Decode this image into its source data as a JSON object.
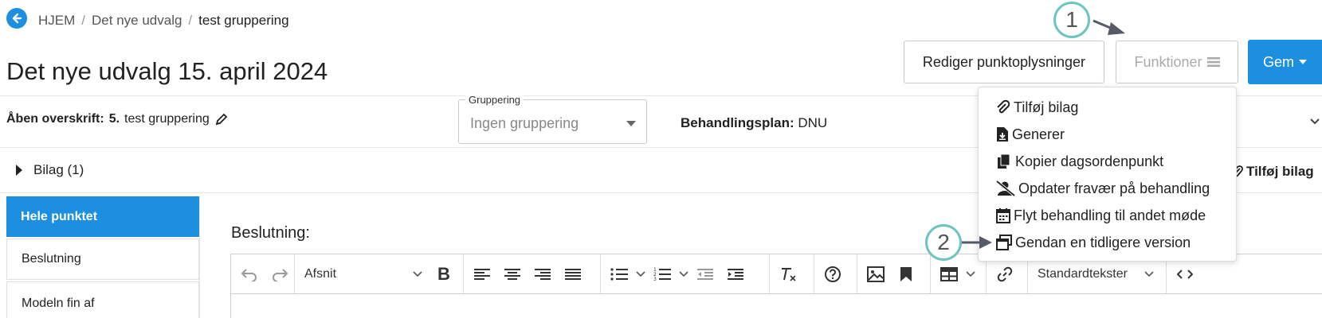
{
  "breadcrumb": {
    "home": "HJEM",
    "parent": "Det nye udvalg",
    "current": "test gruppering",
    "separator": "/"
  },
  "page_title": "Det nye udvalg 15. april 2024",
  "header_buttons": {
    "edit": "Rediger punktoplysninger",
    "functions": "Funktioner",
    "save": "Gem"
  },
  "steps": {
    "one": "1",
    "two": "2"
  },
  "open_heading": {
    "label": "Åben overskrift:",
    "number": "5.",
    "value": "test gruppering"
  },
  "grouping": {
    "label": "Gruppering",
    "value": "Ingen gruppering"
  },
  "plan": {
    "label": "Behandlingsplan:",
    "value": "DNU"
  },
  "bilag": {
    "label": "Bilag (1)",
    "add_label": "Tilføj bilag"
  },
  "sidebar": {
    "items": [
      {
        "label": "Hele punktet",
        "active": true
      },
      {
        "label": "Beslutning"
      },
      {
        "label": "Modeln fin af"
      }
    ]
  },
  "editor": {
    "label": "Beslutning:",
    "paragraph_select": "Afsnit",
    "snippets_select": "Standardtekster"
  },
  "functions_menu": {
    "items": [
      {
        "label": "Tilføj bilag",
        "icon": "paperclip-icon"
      },
      {
        "label": "Generer",
        "icon": "file-download-icon"
      },
      {
        "label": "Kopier dagsordenpunkt",
        "icon": "copy-icon"
      },
      {
        "label": "Opdater fravær på behandling",
        "icon": "user-slash-icon"
      },
      {
        "label": "Flyt behandling til andet møde",
        "icon": "calendar-icon"
      },
      {
        "label": "Gendan en tidligere version",
        "icon": "window-restore-icon"
      }
    ]
  },
  "colors": {
    "primary": "#1c8fe0",
    "step_ring": "#6cc5c0",
    "arrow": "#555a66"
  }
}
